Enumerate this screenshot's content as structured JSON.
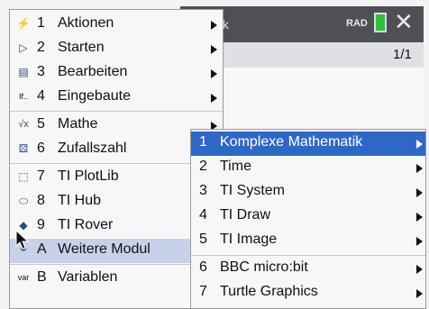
{
  "window": {
    "title_partial": "ok",
    "angle_mode": "RAD",
    "page_counter": "1/1"
  },
  "menu": {
    "items": [
      {
        "key": "1",
        "label": "Aktionen",
        "icon": "lightning-icon"
      },
      {
        "key": "2",
        "label": "Starten",
        "icon": "play-icon"
      },
      {
        "key": "3",
        "label": "Bearbeiten",
        "icon": "edit-icon"
      },
      {
        "key": "4",
        "label": "Eingebaute",
        "icon": "builtin-icon",
        "icon_text": "If.."
      },
      {
        "key": "5",
        "label": "Mathe",
        "icon": "math-icon",
        "icon_text": "√x"
      },
      {
        "key": "6",
        "label": "Zufallszahl",
        "icon": "random-cube-icon"
      },
      {
        "key": "7",
        "label": "TI PlotLib",
        "icon": "plot-icon"
      },
      {
        "key": "8",
        "label": "TI Hub",
        "icon": "hub-icon"
      },
      {
        "key": "9",
        "label": "TI Rover",
        "icon": "rover-icon"
      },
      {
        "key": "A",
        "label": "Weitere Modul",
        "icon": "modules-icon",
        "active": true
      },
      {
        "key": "B",
        "label": "Variablen",
        "icon": "variables-icon",
        "icon_text": "var"
      }
    ]
  },
  "submenu": {
    "items": [
      {
        "key": "1",
        "label": "Komplexe Mathematik",
        "active": true
      },
      {
        "key": "2",
        "label": "Time"
      },
      {
        "key": "3",
        "label": "TI System"
      },
      {
        "key": "4",
        "label": "TI Draw"
      },
      {
        "key": "5",
        "label": "TI Image"
      },
      {
        "key": "6",
        "label": "BBC micro:bit"
      },
      {
        "key": "7",
        "label": "Turtle Graphics"
      }
    ]
  },
  "colors": {
    "highlight": "#2f67c7",
    "hover": "#c7d2e8",
    "titlebar": "#4f4f56",
    "battery": "#2fbf3f"
  }
}
